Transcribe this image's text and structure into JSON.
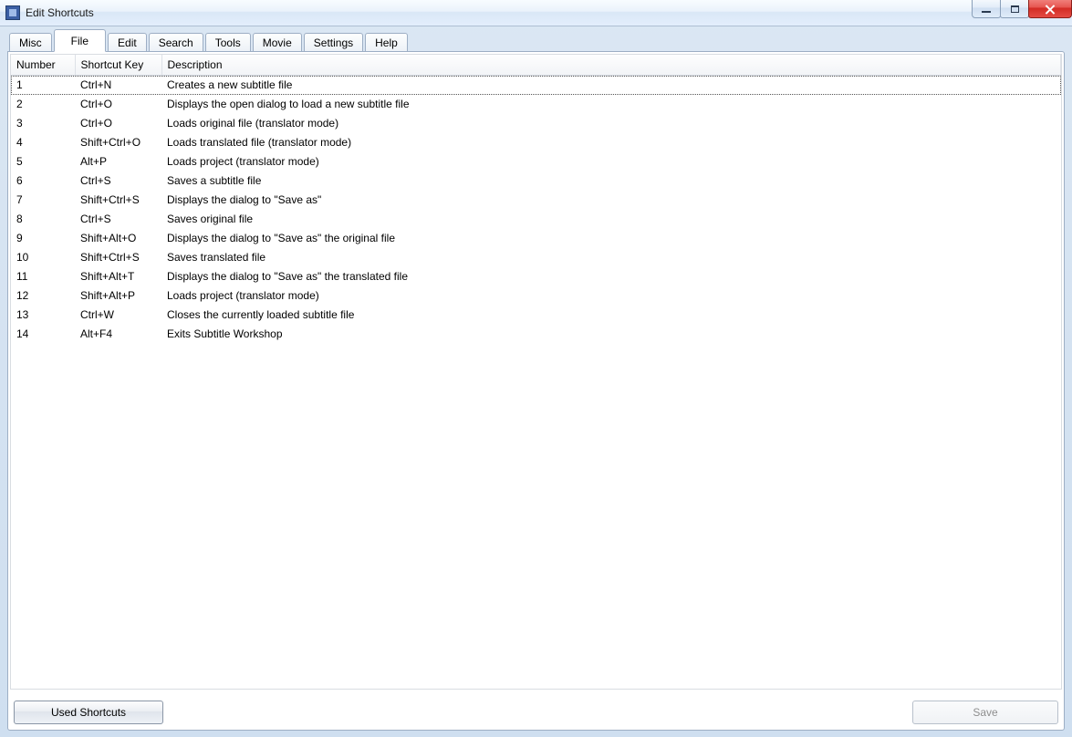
{
  "window": {
    "title": "Edit Shortcuts"
  },
  "tabs": [
    {
      "label": "Misc",
      "active": false
    },
    {
      "label": "File",
      "active": true
    },
    {
      "label": "Edit",
      "active": false
    },
    {
      "label": "Search",
      "active": false
    },
    {
      "label": "Tools",
      "active": false
    },
    {
      "label": "Movie",
      "active": false
    },
    {
      "label": "Settings",
      "active": false
    },
    {
      "label": "Help",
      "active": false
    }
  ],
  "columns": {
    "number": "Number",
    "key": "Shortcut Key",
    "desc": "Description"
  },
  "rows": [
    {
      "number": "1",
      "key": "Ctrl+N",
      "desc": "Creates a new subtitle file"
    },
    {
      "number": "2",
      "key": "Ctrl+O",
      "desc": "Displays the open dialog to load a new subtitle file"
    },
    {
      "number": "3",
      "key": "Ctrl+O",
      "desc": "Loads original file (translator mode)"
    },
    {
      "number": "4",
      "key": "Shift+Ctrl+O",
      "desc": "Loads translated file (translator mode)"
    },
    {
      "number": "5",
      "key": "Alt+P",
      "desc": "Loads project (translator mode)"
    },
    {
      "number": "6",
      "key": "Ctrl+S",
      "desc": "Saves a subtitle file"
    },
    {
      "number": "7",
      "key": "Shift+Ctrl+S",
      "desc": "Displays the dialog to \"Save as\""
    },
    {
      "number": "8",
      "key": "Ctrl+S",
      "desc": "Saves original file"
    },
    {
      "number": "9",
      "key": "Shift+Alt+O",
      "desc": "Displays the dialog to \"Save as\" the original file"
    },
    {
      "number": "10",
      "key": "Shift+Ctrl+S",
      "desc": "Saves translated file"
    },
    {
      "number": "11",
      "key": "Shift+Alt+T",
      "desc": "Displays the dialog to \"Save as\" the translated file"
    },
    {
      "number": "12",
      "key": "Shift+Alt+P",
      "desc": "Loads project (translator mode)"
    },
    {
      "number": "13",
      "key": "Ctrl+W",
      "desc": "Closes the currently loaded subtitle file"
    },
    {
      "number": "14",
      "key": "Alt+F4",
      "desc": "Exits Subtitle Workshop"
    }
  ],
  "buttons": {
    "used": "Used Shortcuts",
    "save": "Save"
  }
}
